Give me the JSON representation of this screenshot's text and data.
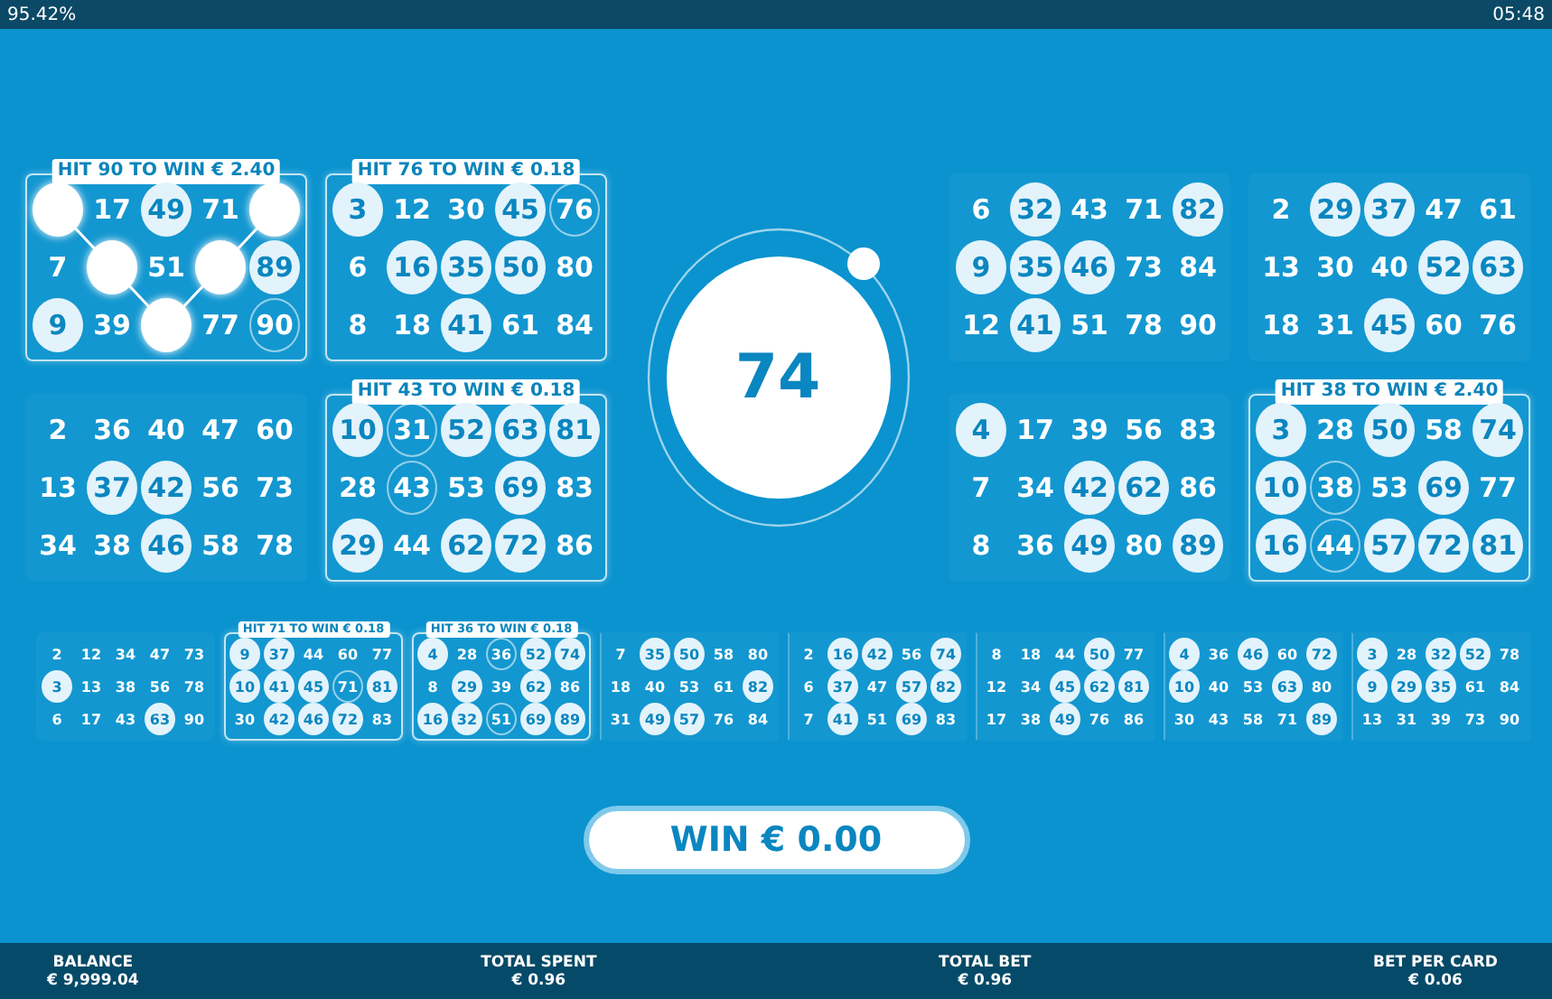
{
  "status_bar": {
    "battery": "95.42%",
    "time": "05:48"
  },
  "top_left_rows": [
    {
      "cards": [
        {
          "hit": "HIT 90 TO WIN € 2.40",
          "win_line": true,
          "cells": [
            {
              "marked": true
            },
            {
              "n": "17",
              "marked": false
            },
            {
              "n": "49",
              "marked": true
            },
            {
              "n": "71",
              "marked": false
            },
            {
              "marked": true
            },
            {
              "n": "7",
              "marked": false
            },
            {
              "marked": true
            },
            {
              "n": "51",
              "marked": false
            },
            {
              "marked": true
            },
            {
              "n": "89",
              "marked": true
            },
            {
              "n": "9",
              "marked": true
            },
            {
              "n": "39",
              "marked": false
            },
            {
              "marked": true
            },
            {
              "n": "77",
              "marked": false
            },
            {
              "n": "90",
              "marked": false,
              "ring": true
            }
          ]
        },
        {
          "hit": "HIT 76 TO WIN € 0.18",
          "cells": [
            {
              "n": "3",
              "marked": true
            },
            {
              "n": "12",
              "marked": false
            },
            {
              "n": "30",
              "marked": false
            },
            {
              "n": "45",
              "marked": true
            },
            {
              "n": "76",
              "marked": false,
              "ring": true
            },
            {
              "n": "6",
              "marked": false
            },
            {
              "n": "16",
              "marked": true
            },
            {
              "n": "35",
              "marked": true
            },
            {
              "n": "50",
              "marked": true
            },
            {
              "n": "80",
              "marked": false
            },
            {
              "n": "8",
              "marked": false
            },
            {
              "n": "18",
              "marked": false
            },
            {
              "n": "41",
              "marked": true
            },
            {
              "n": "61",
              "marked": false
            },
            {
              "n": "84",
              "marked": false
            }
          ]
        }
      ]
    },
    {
      "cards": [
        {
          "cells": [
            {
              "n": "2",
              "marked": false
            },
            {
              "n": "36",
              "marked": false
            },
            {
              "n": "40",
              "marked": false
            },
            {
              "n": "47",
              "marked": false
            },
            {
              "n": "60",
              "marked": false
            },
            {
              "n": "13",
              "marked": false
            },
            {
              "n": "37",
              "marked": true
            },
            {
              "n": "42",
              "marked": true
            },
            {
              "n": "56",
              "marked": false
            },
            {
              "n": "73",
              "marked": false
            },
            {
              "n": "34",
              "marked": false
            },
            {
              "n": "38",
              "marked": false
            },
            {
              "n": "46",
              "marked": true
            },
            {
              "n": "58",
              "marked": false
            },
            {
              "n": "78",
              "marked": false
            }
          ]
        },
        {
          "hit": "HIT 43 TO WIN € 0.18",
          "cells": [
            {
              "n": "10",
              "marked": true
            },
            {
              "n": "31",
              "marked": false,
              "ring": true
            },
            {
              "n": "52",
              "marked": true
            },
            {
              "n": "63",
              "marked": true
            },
            {
              "n": "81",
              "marked": true
            },
            {
              "n": "28",
              "marked": false
            },
            {
              "n": "43",
              "marked": false,
              "ring": true
            },
            {
              "n": "53",
              "marked": false
            },
            {
              "n": "69",
              "marked": true
            },
            {
              "n": "83",
              "marked": false
            },
            {
              "n": "29",
              "marked": true
            },
            {
              "n": "44",
              "marked": false
            },
            {
              "n": "62",
              "marked": true
            },
            {
              "n": "72",
              "marked": true
            },
            {
              "n": "86",
              "marked": false
            }
          ]
        }
      ]
    }
  ],
  "called_ball": "74",
  "top_right_rows": [
    {
      "cards": [
        {
          "cells": [
            {
              "n": "6",
              "marked": false
            },
            {
              "n": "32",
              "marked": true
            },
            {
              "n": "43",
              "marked": false
            },
            {
              "n": "71",
              "marked": false
            },
            {
              "n": "82",
              "marked": true
            },
            {
              "n": "9",
              "marked": true
            },
            {
              "n": "35",
              "marked": true
            },
            {
              "n": "46",
              "marked": true
            },
            {
              "n": "73",
              "marked": false
            },
            {
              "n": "84",
              "marked": false
            },
            {
              "n": "12",
              "marked": false
            },
            {
              "n": "41",
              "marked": true
            },
            {
              "n": "51",
              "marked": false
            },
            {
              "n": "78",
              "marked": false
            },
            {
              "n": "90",
              "marked": false
            }
          ]
        },
        {
          "cells": [
            {
              "n": "2",
              "marked": false
            },
            {
              "n": "29",
              "marked": true
            },
            {
              "n": "37",
              "marked": true
            },
            {
              "n": "47",
              "marked": false
            },
            {
              "n": "61",
              "marked": false
            },
            {
              "n": "13",
              "marked": false
            },
            {
              "n": "30",
              "marked": false
            },
            {
              "n": "40",
              "marked": false
            },
            {
              "n": "52",
              "marked": true
            },
            {
              "n": "63",
              "marked": true
            },
            {
              "n": "18",
              "marked": false
            },
            {
              "n": "31",
              "marked": false
            },
            {
              "n": "45",
              "marked": true
            },
            {
              "n": "60",
              "marked": false
            },
            {
              "n": "76",
              "marked": false
            }
          ]
        }
      ]
    },
    {
      "cards": [
        {
          "cells": [
            {
              "n": "4",
              "marked": true
            },
            {
              "n": "17",
              "marked": false
            },
            {
              "n": "39",
              "marked": false
            },
            {
              "n": "56",
              "marked": false
            },
            {
              "n": "83",
              "marked": false
            },
            {
              "n": "7",
              "marked": false
            },
            {
              "n": "34",
              "marked": false
            },
            {
              "n": "42",
              "marked": true
            },
            {
              "n": "62",
              "marked": true
            },
            {
              "n": "86",
              "marked": false
            },
            {
              "n": "8",
              "marked": false
            },
            {
              "n": "36",
              "marked": false
            },
            {
              "n": "49",
              "marked": true
            },
            {
              "n": "80",
              "marked": false
            },
            {
              "n": "89",
              "marked": true
            }
          ]
        },
        {
          "hit": "HIT 38 TO WIN € 2.40",
          "cells": [
            {
              "n": "3",
              "marked": true
            },
            {
              "n": "28",
              "marked": false
            },
            {
              "n": "50",
              "marked": true
            },
            {
              "n": "58",
              "marked": false
            },
            {
              "n": "74",
              "marked": true
            },
            {
              "n": "10",
              "marked": true
            },
            {
              "n": "38",
              "marked": false,
              "ring": true
            },
            {
              "n": "53",
              "marked": false
            },
            {
              "n": "69",
              "marked": true
            },
            {
              "n": "77",
              "marked": false
            },
            {
              "n": "16",
              "marked": true
            },
            {
              "n": "44",
              "marked": false,
              "ring": true
            },
            {
              "n": "57",
              "marked": true
            },
            {
              "n": "72",
              "marked": true
            },
            {
              "n": "81",
              "marked": true
            }
          ]
        }
      ]
    }
  ],
  "bottom_cards": [
    {
      "cells": [
        {
          "n": "2",
          "marked": false
        },
        {
          "n": "12",
          "marked": false
        },
        {
          "n": "34",
          "marked": false
        },
        {
          "n": "47",
          "marked": false
        },
        {
          "n": "73",
          "marked": false
        },
        {
          "n": "3",
          "marked": true
        },
        {
          "n": "13",
          "marked": false
        },
        {
          "n": "38",
          "marked": false
        },
        {
          "n": "56",
          "marked": false
        },
        {
          "n": "78",
          "marked": false
        },
        {
          "n": "6",
          "marked": false
        },
        {
          "n": "17",
          "marked": false
        },
        {
          "n": "43",
          "marked": false
        },
        {
          "n": "63",
          "marked": true
        },
        {
          "n": "90",
          "marked": false
        }
      ]
    },
    {
      "hit": "HIT 71 TO WIN € 0.18",
      "cells": [
        {
          "n": "9",
          "marked": true
        },
        {
          "n": "37",
          "marked": true
        },
        {
          "n": "44",
          "marked": false
        },
        {
          "n": "60",
          "marked": false
        },
        {
          "n": "77",
          "marked": false
        },
        {
          "n": "10",
          "marked": true
        },
        {
          "n": "41",
          "marked": true
        },
        {
          "n": "45",
          "marked": true
        },
        {
          "n": "71",
          "marked": false,
          "ring": true
        },
        {
          "n": "81",
          "marked": true
        },
        {
          "n": "30",
          "marked": false
        },
        {
          "n": "42",
          "marked": true
        },
        {
          "n": "46",
          "marked": true
        },
        {
          "n": "72",
          "marked": true
        },
        {
          "n": "83",
          "marked": false
        }
      ]
    },
    {
      "hit": "HIT 36 TO WIN € 0.18",
      "cells": [
        {
          "n": "4",
          "marked": true
        },
        {
          "n": "28",
          "marked": false
        },
        {
          "n": "36",
          "marked": false,
          "ring": true
        },
        {
          "n": "52",
          "marked": true
        },
        {
          "n": "74",
          "marked": true
        },
        {
          "n": "8",
          "marked": false
        },
        {
          "n": "29",
          "marked": true
        },
        {
          "n": "39",
          "marked": false
        },
        {
          "n": "62",
          "marked": true
        },
        {
          "n": "86",
          "marked": false
        },
        {
          "n": "16",
          "marked": true
        },
        {
          "n": "32",
          "marked": true
        },
        {
          "n": "51",
          "marked": false,
          "ring": true
        },
        {
          "n": "69",
          "marked": true
        },
        {
          "n": "89",
          "marked": true
        }
      ]
    },
    {
      "cells": [
        {
          "n": "7",
          "marked": false
        },
        {
          "n": "35",
          "marked": true
        },
        {
          "n": "50",
          "marked": true
        },
        {
          "n": "58",
          "marked": false
        },
        {
          "n": "80",
          "marked": false
        },
        {
          "n": "18",
          "marked": false
        },
        {
          "n": "40",
          "marked": false
        },
        {
          "n": "53",
          "marked": false
        },
        {
          "n": "61",
          "marked": false
        },
        {
          "n": "82",
          "marked": true
        },
        {
          "n": "31",
          "marked": false
        },
        {
          "n": "49",
          "marked": true
        },
        {
          "n": "57",
          "marked": true
        },
        {
          "n": "76",
          "marked": false
        },
        {
          "n": "84",
          "marked": false
        }
      ]
    },
    {
      "cells": [
        {
          "n": "2",
          "marked": false
        },
        {
          "n": "16",
          "marked": true
        },
        {
          "n": "42",
          "marked": true
        },
        {
          "n": "56",
          "marked": false
        },
        {
          "n": "74",
          "marked": true
        },
        {
          "n": "6",
          "marked": false
        },
        {
          "n": "37",
          "marked": true
        },
        {
          "n": "47",
          "marked": false
        },
        {
          "n": "57",
          "marked": true
        },
        {
          "n": "82",
          "marked": true
        },
        {
          "n": "7",
          "marked": false
        },
        {
          "n": "41",
          "marked": true
        },
        {
          "n": "51",
          "marked": false
        },
        {
          "n": "69",
          "marked": true
        },
        {
          "n": "83",
          "marked": false
        }
      ]
    },
    {
      "cells": [
        {
          "n": "8",
          "marked": false
        },
        {
          "n": "18",
          "marked": false
        },
        {
          "n": "44",
          "marked": false
        },
        {
          "n": "50",
          "marked": true
        },
        {
          "n": "77",
          "marked": false
        },
        {
          "n": "12",
          "marked": false
        },
        {
          "n": "34",
          "marked": false
        },
        {
          "n": "45",
          "marked": true
        },
        {
          "n": "62",
          "marked": true
        },
        {
          "n": "81",
          "marked": true
        },
        {
          "n": "17",
          "marked": false
        },
        {
          "n": "38",
          "marked": false
        },
        {
          "n": "49",
          "marked": true
        },
        {
          "n": "76",
          "marked": false
        },
        {
          "n": "86",
          "marked": false
        }
      ]
    },
    {
      "cells": [
        {
          "n": "4",
          "marked": true
        },
        {
          "n": "36",
          "marked": false
        },
        {
          "n": "46",
          "marked": true
        },
        {
          "n": "60",
          "marked": false
        },
        {
          "n": "72",
          "marked": true
        },
        {
          "n": "10",
          "marked": true
        },
        {
          "n": "40",
          "marked": false
        },
        {
          "n": "53",
          "marked": false
        },
        {
          "n": "63",
          "marked": true
        },
        {
          "n": "80",
          "marked": false
        },
        {
          "n": "30",
          "marked": false
        },
        {
          "n": "43",
          "marked": false
        },
        {
          "n": "58",
          "marked": false
        },
        {
          "n": "71",
          "marked": false
        },
        {
          "n": "89",
          "marked": true
        }
      ]
    },
    {
      "cells": [
        {
          "n": "3",
          "marked": true
        },
        {
          "n": "28",
          "marked": false
        },
        {
          "n": "32",
          "marked": true
        },
        {
          "n": "52",
          "marked": true
        },
        {
          "n": "78",
          "marked": false
        },
        {
          "n": "9",
          "marked": true
        },
        {
          "n": "29",
          "marked": true
        },
        {
          "n": "35",
          "marked": true
        },
        {
          "n": "61",
          "marked": false
        },
        {
          "n": "84",
          "marked": false
        },
        {
          "n": "13",
          "marked": false
        },
        {
          "n": "31",
          "marked": false
        },
        {
          "n": "39",
          "marked": false
        },
        {
          "n": "73",
          "marked": false
        },
        {
          "n": "90",
          "marked": false
        }
      ]
    }
  ],
  "win_button": "WIN € 0.00",
  "footer": [
    {
      "label": "BALANCE",
      "value": "€ 9,999.04"
    },
    {
      "label": "TOTAL SPENT",
      "value": "€ 0.96"
    },
    {
      "label": "TOTAL BET",
      "value": "€ 0.96"
    },
    {
      "label": "BET PER CARD",
      "value": "€ 0.06"
    }
  ]
}
